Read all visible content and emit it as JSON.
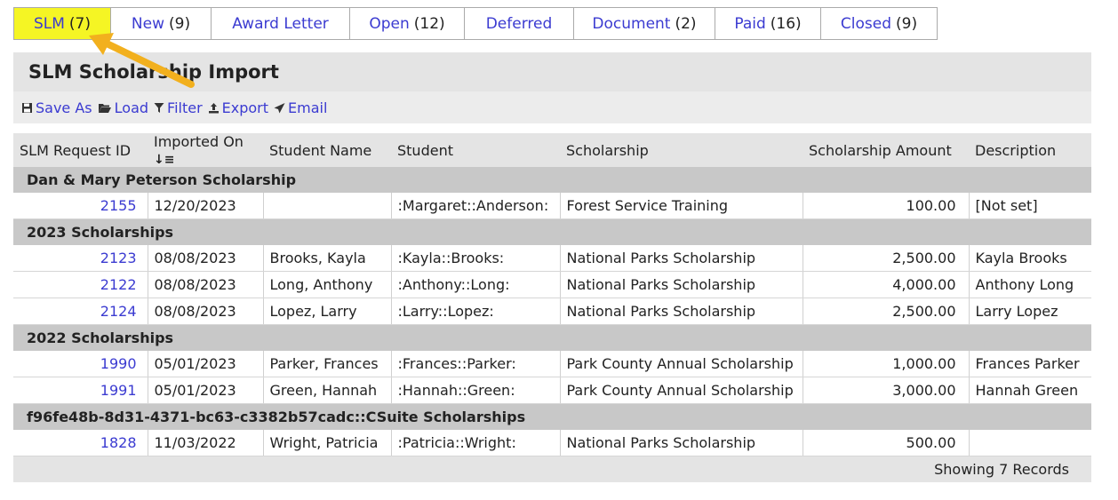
{
  "tabs": [
    {
      "label": "SLM",
      "count": "(7)"
    },
    {
      "label": "New",
      "count": "(9)"
    },
    {
      "label": "Award Letter",
      "count": ""
    },
    {
      "label": "Open",
      "count": "(12)"
    },
    {
      "label": "Deferred",
      "count": ""
    },
    {
      "label": "Document",
      "count": "(2)"
    },
    {
      "label": "Paid",
      "count": "(16)"
    },
    {
      "label": "Closed",
      "count": "(9)"
    }
  ],
  "page_title": "SLM Scholarship Import",
  "toolbar": {
    "save_as": "Save As",
    "load": "Load",
    "filter": "Filter",
    "export": "Export",
    "email": "Email"
  },
  "columns": [
    "SLM Request ID",
    "Imported On",
    "Student Name",
    "Student",
    "Scholarship",
    "Scholarship Amount",
    "Description"
  ],
  "groups": [
    {
      "name": "Dan & Mary Peterson Scholarship",
      "rows": [
        [
          "2155",
          "12/20/2023",
          "",
          ":Margaret::Anderson:",
          "Forest Service Training",
          "100.00",
          "[Not set]"
        ]
      ]
    },
    {
      "name": "2023 Scholarships",
      "rows": [
        [
          "2123",
          "08/08/2023",
          "Brooks, Kayla",
          ":Kayla::Brooks:",
          "National Parks Scholarship",
          "2,500.00",
          "Kayla Brooks"
        ],
        [
          "2122",
          "08/08/2023",
          "Long, Anthony",
          ":Anthony::Long:",
          "National Parks Scholarship",
          "4,000.00",
          "Anthony Long"
        ],
        [
          "2124",
          "08/08/2023",
          "Lopez, Larry",
          ":Larry::Lopez:",
          "National Parks Scholarship",
          "2,500.00",
          "Larry Lopez"
        ]
      ]
    },
    {
      "name": "2022 Scholarships",
      "rows": [
        [
          "1990",
          "05/01/2023",
          "Parker, Frances",
          ":Frances::Parker:",
          "Park County Annual Scholarship",
          "1,000.00",
          "Frances Parker"
        ],
        [
          "1991",
          "05/01/2023",
          "Green, Hannah",
          ":Hannah::Green:",
          "Park County Annual Scholarship",
          "3,000.00",
          "Hannah Green"
        ]
      ]
    },
    {
      "name": "f96fe48b-8d31-4371-bc63-c3382b57cadc::CSuite Scholarships",
      "rows": [
        [
          "1828",
          "11/03/2022",
          "Wright, Patricia",
          ":Patricia::Wright:",
          "National Parks Scholarship",
          "500.00",
          ""
        ]
      ]
    }
  ],
  "footer": "Showing 7 Records",
  "colors": {
    "active_tab": "#f5f524",
    "link": "#3b3bd1",
    "arrow": "#f2b01e"
  },
  "icons": {
    "save_as": "save-icon",
    "load": "folder-open-icon",
    "filter": "filter-icon",
    "export": "export-icon",
    "email": "send-icon",
    "sort": "sort-desc-icon"
  }
}
